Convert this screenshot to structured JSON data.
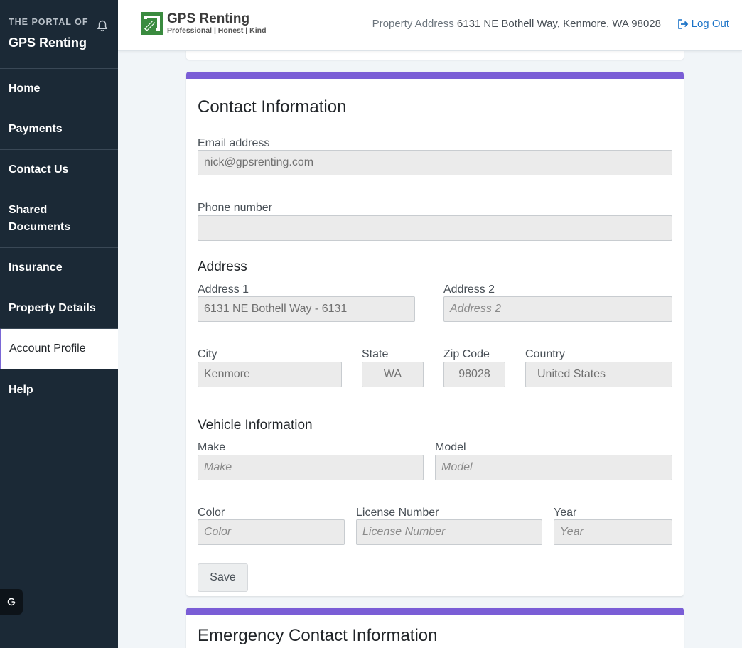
{
  "sidebar": {
    "portal_label": "THE PORTAL OF",
    "brand": "GPS Renting",
    "items": [
      {
        "label": "Home"
      },
      {
        "label": "Payments"
      },
      {
        "label": "Contact Us"
      },
      {
        "label": "Shared Documents"
      },
      {
        "label": "Insurance"
      },
      {
        "label": "Property Details"
      },
      {
        "label": "Account Profile",
        "active": true
      },
      {
        "label": "Help"
      }
    ]
  },
  "header": {
    "logo_name": "GPS Renting",
    "logo_tagline": "Professional | Honest | Kind",
    "property_label": "Property Address",
    "property_address": "6131 NE Bothell Way, Kenmore, WA 98028",
    "logout_label": "Log Out"
  },
  "contact": {
    "title": "Contact Information",
    "email_label": "Email address",
    "email_value": "nick@gpsrenting.com",
    "phone_label": "Phone number",
    "phone_value": "",
    "address_section": "Address",
    "address1_label": "Address 1",
    "address1_value": "6131 NE Bothell Way - 6131",
    "address2_label": "Address 2",
    "address2_placeholder": "Address 2",
    "city_label": "City",
    "city_value": "Kenmore",
    "state_label": "State",
    "state_value": "WA",
    "zip_label": "Zip Code",
    "zip_value": "98028",
    "country_label": "Country",
    "country_value": "United States",
    "vehicle_section": "Vehicle Information",
    "make_label": "Make",
    "make_placeholder": "Make",
    "model_label": "Model",
    "model_placeholder": "Model",
    "color_label": "Color",
    "color_placeholder": "Color",
    "license_label": "License Number",
    "license_placeholder": "License Number",
    "year_label": "Year",
    "year_placeholder": "Year",
    "save_label": "Save"
  },
  "emergency": {
    "title": "Emergency Contact Information"
  },
  "colors": {
    "sidebar_bg": "#1b2936",
    "card_accent": "#7a5dd6",
    "link": "#1a73c8",
    "logo_green": "#3a8b3f"
  }
}
